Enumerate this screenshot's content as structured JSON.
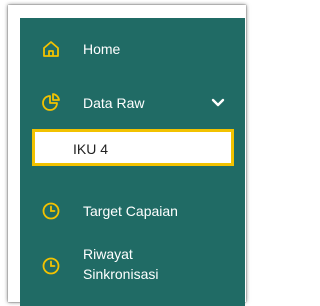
{
  "colors": {
    "sidebar_bg": "#206b65",
    "icon_yellow": "#f2c200",
    "highlight_border": "#f2c200"
  },
  "nav": {
    "home": {
      "label": "Home",
      "icon": "home-icon"
    },
    "data_raw": {
      "label": "Data Raw",
      "icon": "pie-chart-icon",
      "expanded": true,
      "chevron": "chevron-down-icon"
    },
    "data_raw_children": [
      {
        "label": "IKU 4",
        "selected": true
      }
    ],
    "target_capaian": {
      "label": "Target Capaian",
      "icon": "clock-icon"
    },
    "riwayat_sinkronisasi": {
      "label_line1": "Riwayat",
      "label_line2": "Sinkronisasi",
      "icon": "clock-icon"
    }
  }
}
